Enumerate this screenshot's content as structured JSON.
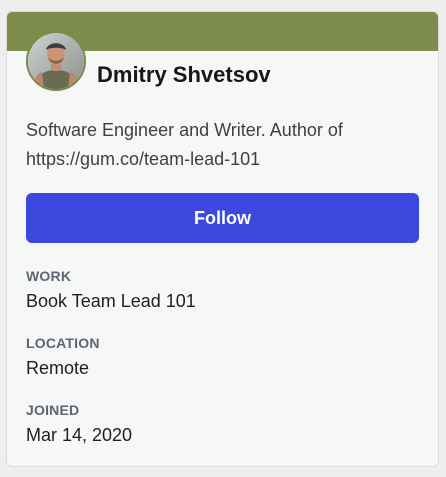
{
  "profile": {
    "name": "Dmitry Shvetsov",
    "bio": "Software Engineer and Writer. Author of https://gum.co/team-lead-101",
    "brand_color": "#7f8d4c",
    "avatar_icon": "user-photo"
  },
  "actions": {
    "follow_label": "Follow",
    "follow_color": "#3b49df"
  },
  "details": [
    {
      "label": "WORK",
      "value": "Book Team Lead 101"
    },
    {
      "label": "LOCATION",
      "value": "Remote"
    },
    {
      "label": "JOINED",
      "value": "Mar 14, 2020"
    }
  ]
}
